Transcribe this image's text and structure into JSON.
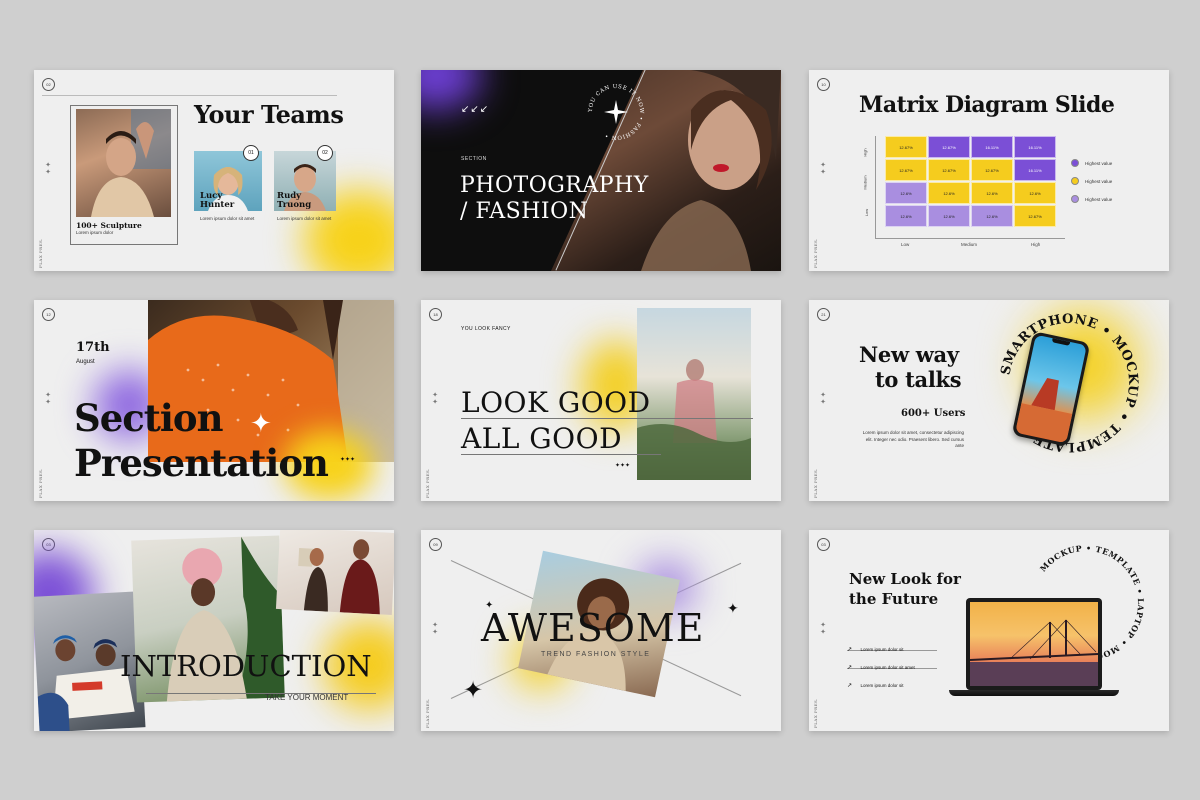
{
  "colors": {
    "background": "#cfcfcf",
    "slide": "#efefef",
    "purple": "#7b4fd6",
    "yellow": "#f5cc1e",
    "lavender": "#a98ee0",
    "dark": "#0e0e0e"
  },
  "brand_vertical": "FLAX PRES.",
  "slides": {
    "teams": {
      "page": "02",
      "title": "Your Teams",
      "sculpture": "100+ Sculpture",
      "sculpture_sub": "Lorem ipsum dolor",
      "member1_num": "01",
      "member1_name": "Lucy Hunter",
      "member1_text": "Lorem ipsum dolor sit amet",
      "member2_num": "02",
      "member2_name": "Rudy Truong",
      "member2_text": "Lorem ipsum dolor sit amet"
    },
    "photo_fashion": {
      "arrows": "↙↙↙",
      "section": "SECTION",
      "title_line1": "PHOTOGRAPHY",
      "title_line2": "/ FASHION",
      "ring_text": "YOU CAN USE IT NOW • FASHION •"
    },
    "matrix": {
      "page": "10",
      "title": "Matrix Diagram Slide",
      "y_labels": [
        "High",
        "Medium",
        "Low"
      ],
      "x_labels": [
        "Low",
        "Medium",
        "High"
      ],
      "rows": [
        [
          "12.67%",
          "12.67%",
          "16.11%",
          "16.11%"
        ],
        [
          "12.67%",
          "12.67%",
          "12.67%",
          "16.11%"
        ],
        [
          "12.6%",
          "12.6%",
          "12.6%",
          "12.6%"
        ],
        [
          "12.6%",
          "12.6%",
          "12.6%",
          "12.67%"
        ]
      ],
      "legend": [
        "Highest value",
        "Highest value",
        "Highest value"
      ]
    },
    "section": {
      "page": "12",
      "day": "17th",
      "month": "August",
      "title_line1": "Section",
      "title_line2": "Presentation",
      "dots": "✦✦✦"
    },
    "lookgood": {
      "page": "18",
      "kicker": "YOU LOOK FANCY",
      "line1": "LOOK GOOD",
      "line2": "ALL GOOD",
      "dots": "✦✦✦"
    },
    "smartphone": {
      "page": "21",
      "title_line1": "New way",
      "title_line2": "to talks",
      "users": "600+ Users",
      "body": "Lorem ipsum dolor sit amet, consectetur adipiscing elit. Integer nec odio. Praesent libero. Sed cursus ante",
      "ring_text": "SMARTPHONE • MOCKUP • TEMPLATE"
    },
    "intro": {
      "page": "03",
      "title": "INTRODUCTION",
      "sub": "TAKE YOUR MOMENT"
    },
    "awesome": {
      "page": "09",
      "title": "AWESOME",
      "sub": "TREND FASHION STYLE"
    },
    "laptop": {
      "page": "03",
      "title_line1": "New Look for",
      "title_line2": "the Future",
      "items": [
        "Lorem ipsum dolor sit",
        "Lorem ipsum dolor sit amet",
        "Lorem ipsum dolor sit"
      ],
      "ring_text": "MOCKUP • TEMPLATE • LAPTOP • MOCKUP •"
    }
  }
}
